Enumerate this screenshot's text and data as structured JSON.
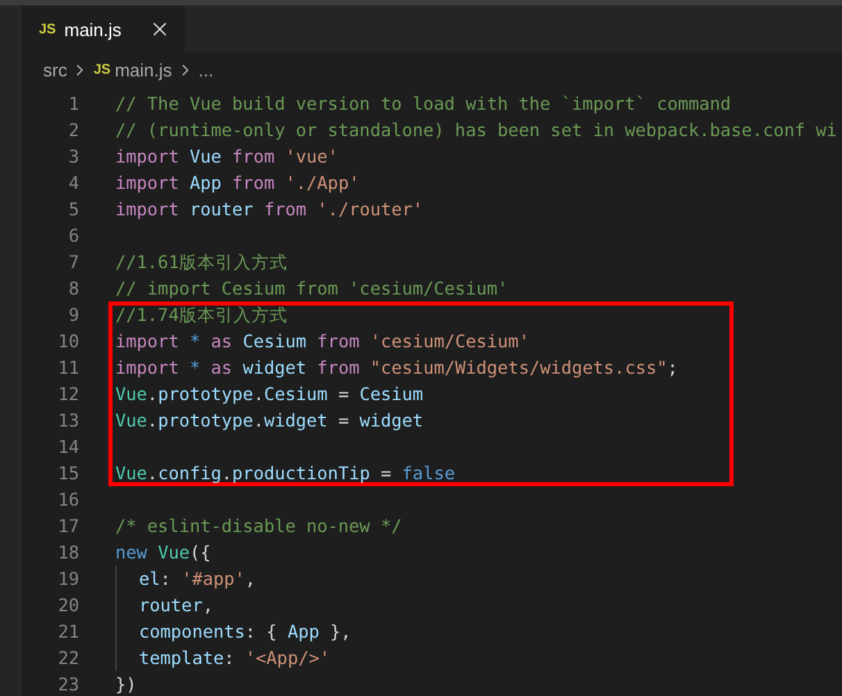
{
  "tab": {
    "icon_text": "JS",
    "label": "main.js",
    "selected": true
  },
  "breadcrumb": {
    "folder": "src",
    "file_icon_text": "JS",
    "file": "main.js",
    "tail": "..."
  },
  "lines": [
    {
      "number": "1",
      "boxed": false,
      "indent": false,
      "tokens": [
        {
          "kind": "comment",
          "text": "// The Vue build version to load with the `import` command"
        }
      ]
    },
    {
      "number": "2",
      "boxed": false,
      "indent": false,
      "tokens": [
        {
          "kind": "comment",
          "text": "// (runtime-only or standalone) has been set in webpack.base.conf wi"
        }
      ]
    },
    {
      "number": "3",
      "boxed": false,
      "indent": false,
      "tokens": [
        {
          "kind": "keyword",
          "text": "import "
        },
        {
          "kind": "variable",
          "text": "Vue "
        },
        {
          "kind": "keyword",
          "text": "from "
        },
        {
          "kind": "string",
          "text": "'vue'"
        }
      ]
    },
    {
      "number": "4",
      "boxed": false,
      "indent": false,
      "tokens": [
        {
          "kind": "keyword",
          "text": "import "
        },
        {
          "kind": "variable",
          "text": "App "
        },
        {
          "kind": "keyword",
          "text": "from "
        },
        {
          "kind": "string",
          "text": "'./App'"
        }
      ]
    },
    {
      "number": "5",
      "boxed": false,
      "indent": false,
      "tokens": [
        {
          "kind": "keyword",
          "text": "import "
        },
        {
          "kind": "variable",
          "text": "router "
        },
        {
          "kind": "keyword",
          "text": "from "
        },
        {
          "kind": "string",
          "text": "'./router'"
        }
      ]
    },
    {
      "number": "6",
      "boxed": false,
      "indent": false
    },
    {
      "number": "7",
      "boxed": false,
      "indent": false,
      "tokens": [
        {
          "kind": "comment",
          "text": "//1.61版本引入方式"
        }
      ]
    },
    {
      "number": "8",
      "boxed": false,
      "indent": false,
      "tokens": [
        {
          "kind": "comment",
          "text": "// import Cesium from 'cesium/Cesium'"
        }
      ]
    },
    {
      "number": "9",
      "boxed": true,
      "indent": false,
      "tokens": [
        {
          "kind": "comment",
          "text": "//1.74版本引入方式"
        }
      ]
    },
    {
      "number": "10",
      "boxed": true,
      "indent": false,
      "tokens": [
        {
          "kind": "keyword",
          "text": "import "
        },
        {
          "kind": "builtin",
          "text": "* "
        },
        {
          "kind": "keyword",
          "text": "as "
        },
        {
          "kind": "variable",
          "text": "Cesium "
        },
        {
          "kind": "keyword",
          "text": "from "
        },
        {
          "kind": "string",
          "text": "'cesium/Cesium'"
        }
      ]
    },
    {
      "number": "11",
      "boxed": true,
      "indent": false,
      "tokens": [
        {
          "kind": "keyword",
          "text": "import "
        },
        {
          "kind": "builtin",
          "text": "* "
        },
        {
          "kind": "keyword",
          "text": "as "
        },
        {
          "kind": "variable",
          "text": "widget "
        },
        {
          "kind": "keyword",
          "text": "from "
        },
        {
          "kind": "string",
          "text": "\"cesium/Widgets/widgets.css\""
        },
        {
          "kind": "plain",
          "text": ";"
        }
      ]
    },
    {
      "number": "12",
      "boxed": true,
      "indent": false,
      "tokens": [
        {
          "kind": "class",
          "text": "Vue"
        },
        {
          "kind": "plain",
          "text": "."
        },
        {
          "kind": "variable",
          "text": "prototype"
        },
        {
          "kind": "plain",
          "text": "."
        },
        {
          "kind": "variable",
          "text": "Cesium "
        },
        {
          "kind": "plain",
          "text": "= "
        },
        {
          "kind": "variable",
          "text": "Cesium"
        }
      ]
    },
    {
      "number": "13",
      "boxed": true,
      "indent": false,
      "tokens": [
        {
          "kind": "class",
          "text": "Vue"
        },
        {
          "kind": "plain",
          "text": "."
        },
        {
          "kind": "variable",
          "text": "prototype"
        },
        {
          "kind": "plain",
          "text": "."
        },
        {
          "kind": "variable",
          "text": "widget "
        },
        {
          "kind": "plain",
          "text": "= "
        },
        {
          "kind": "variable",
          "text": "widget"
        }
      ]
    },
    {
      "number": "14",
      "boxed": true,
      "indent": false
    },
    {
      "number": "15",
      "boxed": true,
      "indent": false,
      "tokens": [
        {
          "kind": "class",
          "text": "Vue"
        },
        {
          "kind": "plain",
          "text": "."
        },
        {
          "kind": "variable",
          "text": "config"
        },
        {
          "kind": "plain",
          "text": "."
        },
        {
          "kind": "variable",
          "text": "productionTip "
        },
        {
          "kind": "plain",
          "text": "= "
        },
        {
          "kind": "builtin",
          "text": "false"
        }
      ]
    },
    {
      "number": "16",
      "boxed": false,
      "indent": false
    },
    {
      "number": "17",
      "boxed": false,
      "indent": false,
      "tokens": [
        {
          "kind": "comment",
          "text": "/* eslint-disable no-new */"
        }
      ]
    },
    {
      "number": "18",
      "boxed": false,
      "indent": false,
      "tokens": [
        {
          "kind": "builtin",
          "text": "new "
        },
        {
          "kind": "class",
          "text": "Vue"
        },
        {
          "kind": "plain",
          "text": "({"
        }
      ]
    },
    {
      "number": "19",
      "boxed": false,
      "indent": true,
      "tokens": [
        {
          "kind": "variable",
          "text": "el"
        },
        {
          "kind": "plain",
          "text": ": "
        },
        {
          "kind": "string",
          "text": "'#app'"
        },
        {
          "kind": "plain",
          "text": ","
        }
      ]
    },
    {
      "number": "20",
      "boxed": false,
      "indent": true,
      "tokens": [
        {
          "kind": "variable",
          "text": "router"
        },
        {
          "kind": "plain",
          "text": ","
        }
      ]
    },
    {
      "number": "21",
      "boxed": false,
      "indent": true,
      "tokens": [
        {
          "kind": "variable",
          "text": "components"
        },
        {
          "kind": "plain",
          "text": ": { "
        },
        {
          "kind": "variable",
          "text": "App "
        },
        {
          "kind": "plain",
          "text": "},"
        }
      ]
    },
    {
      "number": "22",
      "boxed": false,
      "indent": true,
      "tokens": [
        {
          "kind": "variable",
          "text": "template"
        },
        {
          "kind": "plain",
          "text": ": "
        },
        {
          "kind": "string",
          "text": "'<App/>'"
        }
      ]
    },
    {
      "number": "23",
      "boxed": false,
      "indent": false,
      "tokens": [
        {
          "kind": "plain",
          "text": "})"
        }
      ]
    }
  ]
}
